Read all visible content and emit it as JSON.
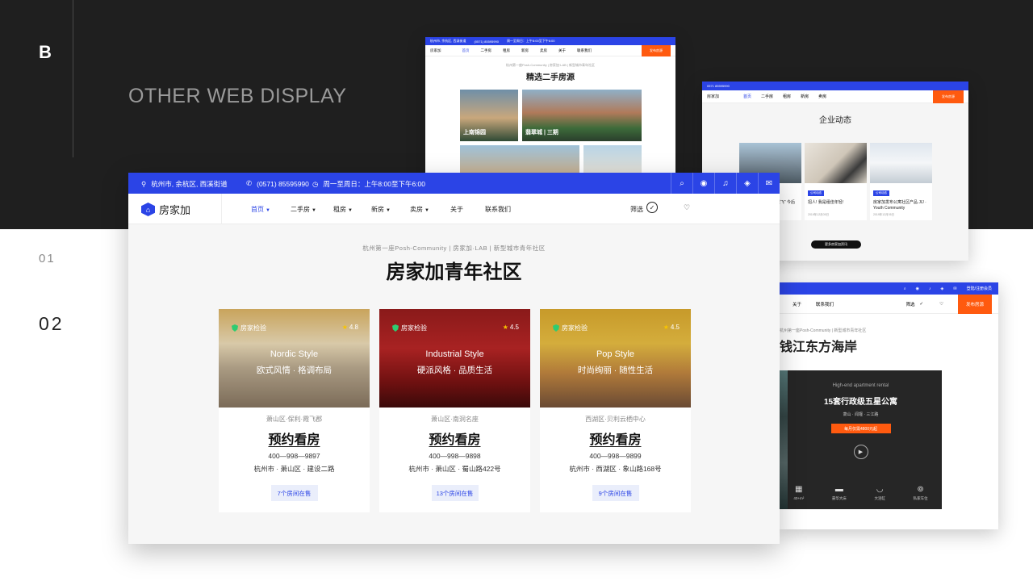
{
  "brand_letter": "B",
  "headline": "OTHER WEB DISPLAY",
  "section_numbers": [
    "01",
    "02"
  ],
  "colors": {
    "accent": "#2b44e6",
    "orange": "#ff5a0f",
    "dark_bg": "#1f1f1f"
  },
  "shotA": {
    "topbar": [
      "杭州市, 余杭区, 西溪街道",
      "(0571) 85595990",
      "周一至周日：上午8:00至下午6:00"
    ],
    "nav": [
      "首页",
      "二手房",
      "租房",
      "新房",
      "卖房",
      "关于",
      "联系我们"
    ],
    "publish": "发布房源",
    "subtitle": "杭州第一座Posh-Community | 房家加·LAB | 新型城市青年社区",
    "title": "精选二手房源",
    "photos": [
      "上南锦园",
      "翡翠城 | 三期",
      "",
      ""
    ]
  },
  "shotC": {
    "topbar": "0571 85595990",
    "nav": [
      "首页",
      "二手房",
      "租房",
      "新房",
      "卖房"
    ],
    "publish": "发布房源",
    "title": "企业动态",
    "news": [
      {
        "tag": "公司动态",
        "text": "三大风口推动租赁\"起飞\" 今后服务将出现关键",
        "date": "2019年12月05日"
      },
      {
        "tag": "公司动态",
        "text": "招人! 我是租佳年轻!",
        "date": "2019年12月05日"
      },
      {
        "tag": "公司动态",
        "text": "房家加发布公寓社区产品 JIJ · Youth Community",
        "date": "2019年12月05日"
      }
    ],
    "more": "更多房家加资讯"
  },
  "shotD": {
    "topbar": "登陆/注册会员",
    "nav": [
      "关于",
      "联系我们"
    ],
    "filter": "筛选",
    "publish": "发布房源",
    "subtitle": "杭州第一座Posh-Community | 新型城市青年社区",
    "title": "钱江东方海岸",
    "box": {
      "hint": "High-end apartment rental",
      "headline": "15套行政级五星公寓",
      "location": "萧山 · 闻堰 · 三江路",
      "cta": "每月仅需4800元起",
      "amenities": [
        "40+m²",
        "豪华大床",
        "大浴缸",
        "私家车位"
      ]
    }
  },
  "main": {
    "topbar": {
      "location": "杭州市, 余杭区, 西溪街道",
      "phone": "(0571) 85595990",
      "hours": "周一至周日：上午8:00至下午6:00"
    },
    "logo": "房家加",
    "nav": [
      "首页",
      "二手房",
      "租房",
      "新房",
      "卖房",
      "关于",
      "联系我们"
    ],
    "filter": "筛选",
    "subtitle": "杭州第一座Posh-Community | 房家加·LAB | 新型城市青年社区",
    "title": "房家加青年社区",
    "cards": [
      {
        "badge": "房家检验",
        "rating": "4.8",
        "style_en": "Nordic Style",
        "style_zh": "欧式风情 · 格调布局",
        "area": "萧山区·保利·霞飞郡",
        "book": "预约看房",
        "phone": "400—998—9897",
        "address": "杭州市 · 萧山区 · 建设二路",
        "rooms": "7个房间在售"
      },
      {
        "badge": "房家检验",
        "rating": "4.5",
        "style_en": "Industrial Style",
        "style_zh": "硬派风格 · 品质生活",
        "area": "萧山区·南洞名座",
        "book": "预约看房",
        "phone": "400—998—9898",
        "address": "杭州市 · 萧山区 · 蜀山路422号",
        "rooms": "13个房间在售"
      },
      {
        "badge": "房家检验",
        "rating": "4.5",
        "style_en": "Pop Style",
        "style_zh": "时尚绚丽 · 随性生活",
        "area": "西湖区·贝利云栖中心",
        "book": "预约看房",
        "phone": "400—998—9899",
        "address": "杭州市 · 西湖区 · 象山路168号",
        "rooms": "9个房间在售"
      }
    ]
  }
}
